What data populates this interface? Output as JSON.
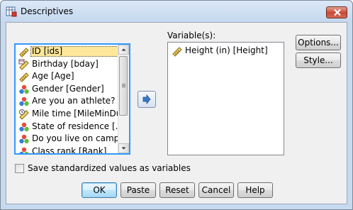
{
  "window": {
    "title": "Descriptives"
  },
  "source_list": {
    "items": [
      {
        "label": "ID [ids]",
        "icon": "scale-ruler-icon",
        "selected": true
      },
      {
        "label": "Birthday [bday]",
        "icon": "date-ruler-icon"
      },
      {
        "label": "Age [Age]",
        "icon": "scale-ruler-icon"
      },
      {
        "label": "Gender [Gender]",
        "icon": "nominal-balls-icon"
      },
      {
        "label": "Are you an athlete? [...",
        "icon": "nominal-balls-icon"
      },
      {
        "label": "Mile time [MileMinDur]",
        "icon": "time-ruler-icon"
      },
      {
        "label": "State of residence [...",
        "icon": "nominal-balls-icon"
      },
      {
        "label": "Do you live on camp...",
        "icon": "nominal-balls-icon"
      },
      {
        "label": "Class rank [Rank]",
        "icon": "nominal-balls-icon"
      }
    ]
  },
  "target": {
    "label": "Variable(s):",
    "items": [
      {
        "label": "Height (in) [Height]",
        "icon": "scale-ruler-icon"
      }
    ]
  },
  "side_buttons": {
    "options": "Options...",
    "style": "Style..."
  },
  "checkbox": {
    "label": "Save standardized values as variables",
    "checked": false
  },
  "bottom_buttons": {
    "ok": "OK",
    "paste": "Paste",
    "reset": "Reset",
    "cancel": "Cancel",
    "help": "Help"
  },
  "colors": {
    "selection": "#fde79a",
    "focus_border": "#3399ff",
    "client_bg": "#f0f0f0"
  }
}
